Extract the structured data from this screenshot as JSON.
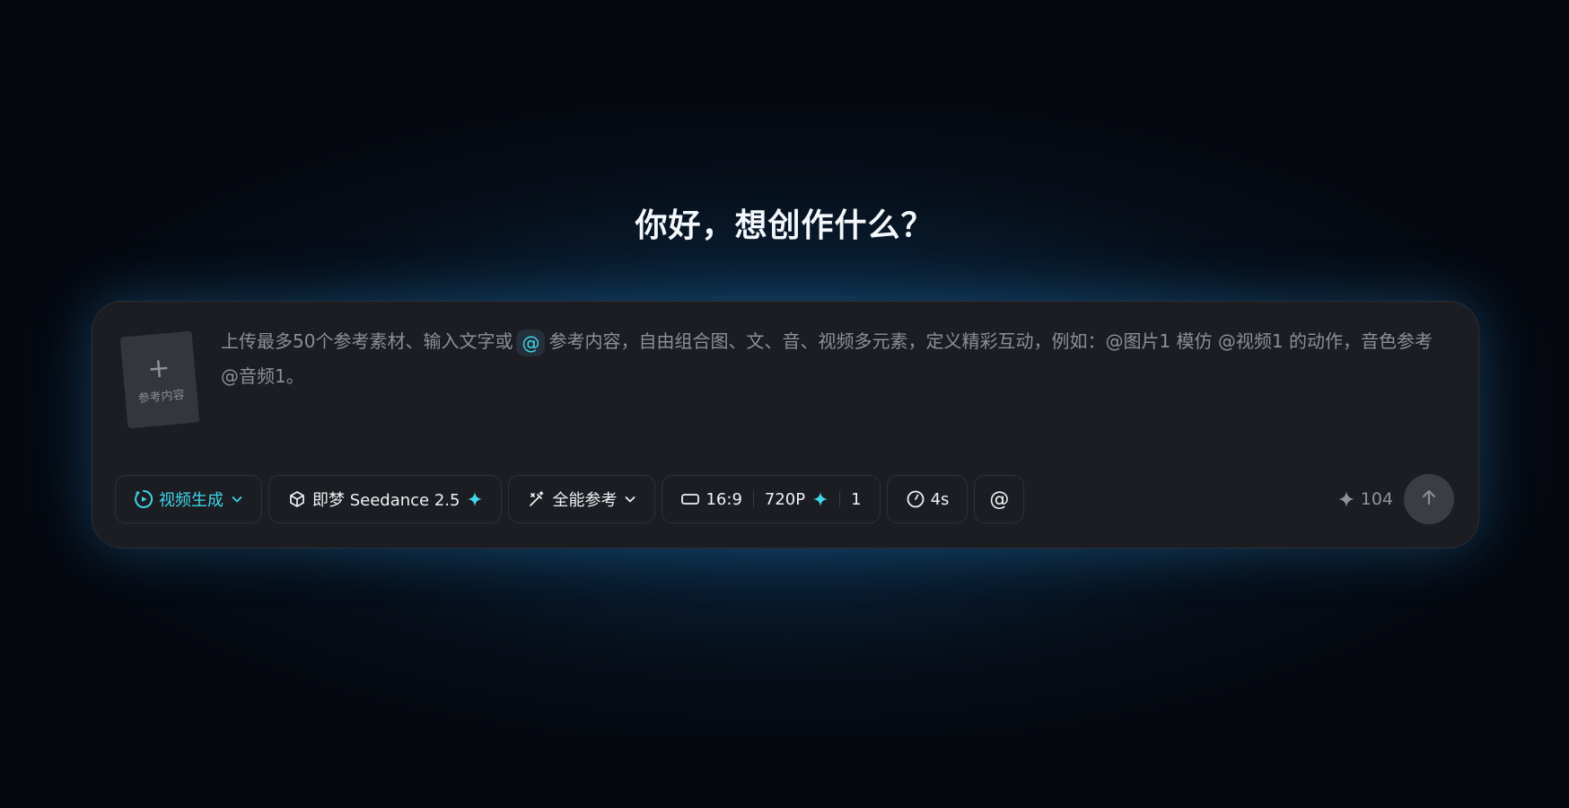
{
  "title": "你好，想创作什么？",
  "reference_card": {
    "plus": "+",
    "label": "参考内容"
  },
  "prompt": {
    "placeholder_before": "上传最多50个参考素材、输入文字或",
    "at_symbol": "@",
    "placeholder_after": "参考内容，自由组合图、文、音、视频多元素，定义精彩互动，例如：@图片1 模仿 @视频1 的动作，音色参考 @音频1。"
  },
  "toolbar": {
    "mode_label": "视频生成",
    "model_label": "即梦 Seedance 2.5",
    "reference_mode_label": "全能参考",
    "ratio_label": "16:9",
    "resolution_label": "720P",
    "count_label": "1",
    "duration_label": "4s",
    "mention_label": "@"
  },
  "credits": {
    "value": "104"
  },
  "colors": {
    "accent": "#3fd6ea",
    "panel": "#1c1d22",
    "background": "#05080f",
    "glow": "#2678b4"
  },
  "icons": {
    "mode": "video-generate-icon",
    "model": "cube-icon",
    "reference_mode": "magic-wand-icon",
    "ratio": "aspect-ratio-icon",
    "resolution": "sparkle-icon",
    "duration": "clock-icon",
    "credits": "sparkle-icon",
    "send": "arrow-up-icon"
  }
}
